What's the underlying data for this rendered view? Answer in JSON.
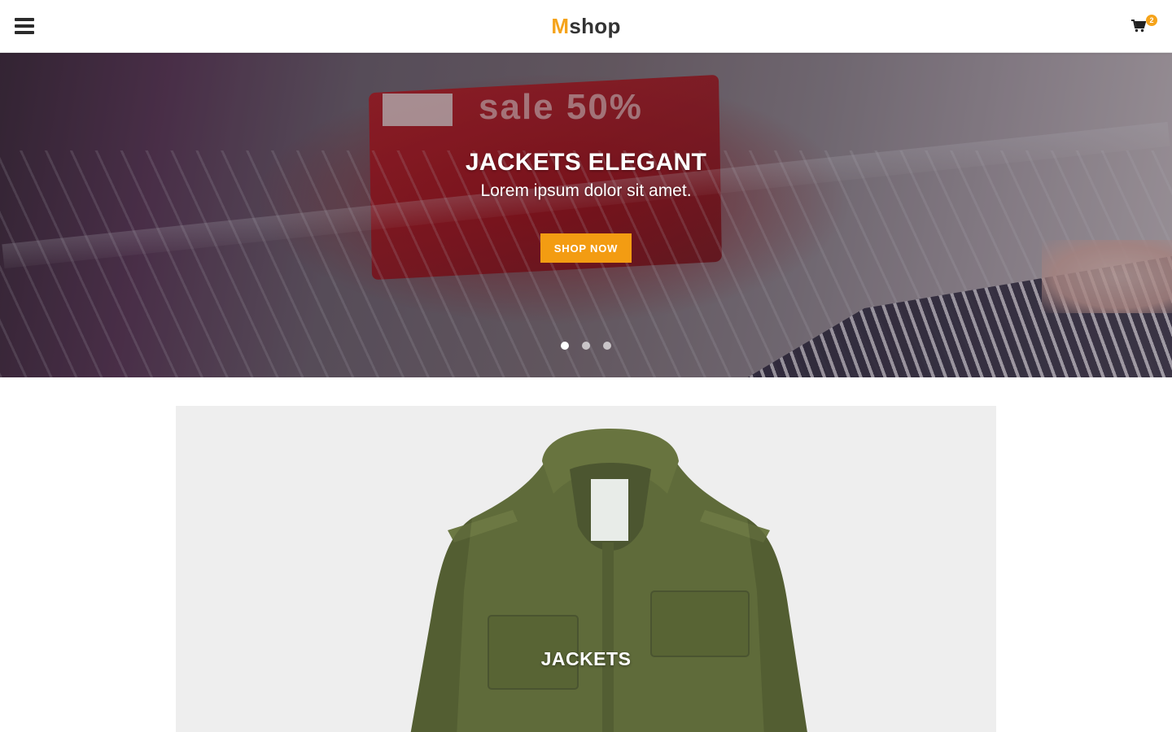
{
  "header": {
    "logo_first": "M",
    "logo_rest": "shop",
    "cart_count": "2"
  },
  "hero": {
    "title": "JACKETS ELEGANT",
    "subtitle": "Lorem ipsum dolor sit amet.",
    "cta_label": "SHOP NOW",
    "sign_text": "sale 50%",
    "slides_total": 3,
    "active_slide": 1
  },
  "category": {
    "label": "JACKETS"
  },
  "icons": {
    "menu": "hamburger-menu-icon",
    "cart": "shopping-cart-icon"
  },
  "colors": {
    "accent": "#f39c12",
    "logo_accent": "#f5a31a",
    "text_dark": "#333333",
    "card_bg": "#eeeeee"
  }
}
